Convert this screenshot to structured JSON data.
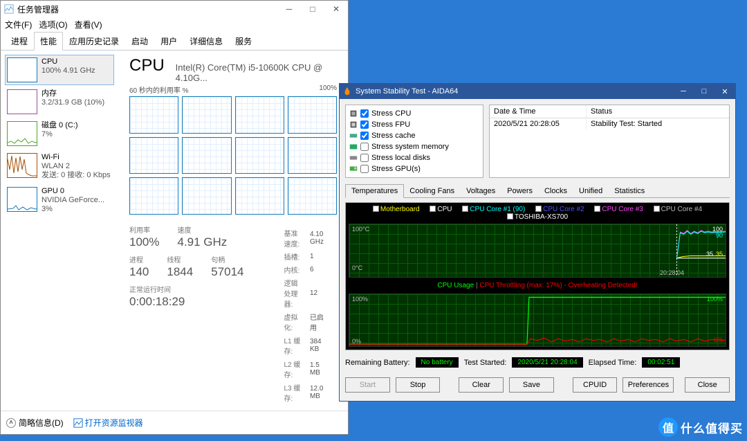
{
  "tm": {
    "window_title": "任务管理器",
    "menu": {
      "file": "文件(F)",
      "options": "选项(O)",
      "view": "查看(V)"
    },
    "tabs": {
      "processes": "进程",
      "performance": "性能",
      "app_history": "应用历史记录",
      "startup": "启动",
      "users": "用户",
      "details": "详细信息",
      "services": "服务"
    },
    "resources": {
      "cpu": {
        "name": "CPU",
        "sub": "100%  4.91 GHz"
      },
      "mem": {
        "name": "内存",
        "sub": "3.2/31.9 GB (10%)"
      },
      "disk": {
        "name": "磁盘 0 (C:)",
        "sub": "7%"
      },
      "wifi": {
        "name": "Wi-Fi",
        "sub1": "WLAN 2",
        "sub2": "发送: 0  接收: 0 Kbps"
      },
      "gpu": {
        "name": "GPU 0",
        "sub1": "NVIDIA GeForce...",
        "sub2": "3%"
      }
    },
    "header": {
      "cpu_title": "CPU",
      "cpu_desc": "Intel(R) Core(TM) i5-10600K CPU @ 4.10G...",
      "chart_label": "60 秒内的利用率 %",
      "max": "100%"
    },
    "stats": {
      "util_lbl": "利用率",
      "util_val": "100%",
      "speed_lbl": "速度",
      "speed_val": "4.91 GHz",
      "proc_lbl": "进程",
      "proc_val": "140",
      "threads_lbl": "线程",
      "threads_val": "1844",
      "handles_lbl": "句柄",
      "handles_val": "57014",
      "uptime_lbl": "正常运行时间",
      "uptime_val": "0:00:18:29"
    },
    "spec": {
      "base_lbl": "基准速度:",
      "base": "4.10 GHz",
      "sockets_lbl": "插槽:",
      "sockets": "1",
      "cores_lbl": "内核:",
      "cores": "6",
      "lproc_lbl": "逻辑处理器:",
      "lproc": "12",
      "virt_lbl": "虚拟化:",
      "virt": "已启用",
      "l1_lbl": "L1 缓存:",
      "l1": "384 KB",
      "l2_lbl": "L2 缓存:",
      "l2": "1.5 MB",
      "l3_lbl": "L3 缓存:",
      "l3": "12.0 MB"
    },
    "footer": {
      "fewer": "简略信息(D)",
      "monitor": "打开资源监视器"
    }
  },
  "aida": {
    "title": "System Stability Test - AIDA64",
    "stress": {
      "cpu": "Stress CPU",
      "fpu": "Stress FPU",
      "cache": "Stress cache",
      "mem": "Stress system memory",
      "disk": "Stress local disks",
      "gpu": "Stress GPU(s)"
    },
    "log": {
      "col1": "Date & Time",
      "col2": "Status",
      "r1c1": "2020/5/21 20:28:05",
      "r1c2": "Stability Test: Started"
    },
    "tabs": {
      "temp": "Temperatures",
      "fans": "Cooling Fans",
      "volt": "Voltages",
      "power": "Powers",
      "clocks": "Clocks",
      "unified": "Unified",
      "stats": "Statistics"
    },
    "legend1": {
      "mb": "Motherboard",
      "cpu": "CPU",
      "c1": "CPU Core #1 (90)",
      "c2": "CPU Core #2",
      "c3": "CPU Core #3",
      "c4": "CPU Core #4",
      "ssd": "TOSHIBA-XS700"
    },
    "chart1": {
      "ymax": "100°C",
      "ymin": "0°C",
      "xtick": "20:28:04",
      "r_top": "100",
      "r_90": "90",
      "r_35a": "35",
      "r_35b": "35"
    },
    "chart2": {
      "title_usage": "CPU Usage",
      "title_throttle": "CPU Throttling (max: 17%) - Overheating Detected!",
      "ymax": "100%",
      "ymin": "0%",
      "r_top": "100%",
      "r_low": "6%"
    },
    "status": {
      "batt_lbl": "Remaining Battery:",
      "batt": "No battery",
      "start_lbl": "Test Started:",
      "start": "2020/5/21 20:28:04",
      "elapsed_lbl": "Elapsed Time:",
      "elapsed": "00:02:51"
    },
    "btns": {
      "start": "Start",
      "stop": "Stop",
      "clear": "Clear",
      "save": "Save",
      "cpuid": "CPUID",
      "prefs": "Preferences",
      "close": "Close"
    }
  },
  "watermark": {
    "icon": "值",
    "text": "什么值得买"
  },
  "chart_data": [
    {
      "type": "line",
      "title": "Task Manager CPU per-logical-processor utilization (12 cells)",
      "cells": 12,
      "range_sec": 60,
      "ymax_percent": 100,
      "current_percent": 100
    },
    {
      "type": "line",
      "title": "AIDA64 Temperatures",
      "ylabel": "°C",
      "ylim": [
        0,
        100
      ],
      "series": [
        {
          "name": "Motherboard",
          "color": "#ffff00"
        },
        {
          "name": "CPU",
          "color": "#ffffff"
        },
        {
          "name": "CPU Core #1",
          "color": "#00ffff",
          "current": 90
        },
        {
          "name": "CPU Core #2",
          "color": "#0000ff"
        },
        {
          "name": "CPU Core #3",
          "color": "#ff00ff"
        },
        {
          "name": "CPU Core #4",
          "color": "#a0a0a0"
        },
        {
          "name": "TOSHIBA-XS700",
          "color": "#ffffff",
          "current": 35
        }
      ],
      "xtick": "20:28:04"
    },
    {
      "type": "line",
      "title": "AIDA64 CPU Usage / Throttling",
      "ylabel": "%",
      "ylim": [
        0,
        100
      ],
      "series": [
        {
          "name": "CPU Usage",
          "color": "#00ff00",
          "current": 100
        },
        {
          "name": "CPU Throttling",
          "color": "#ff0000",
          "max": 17,
          "current": 6
        }
      ]
    }
  ]
}
